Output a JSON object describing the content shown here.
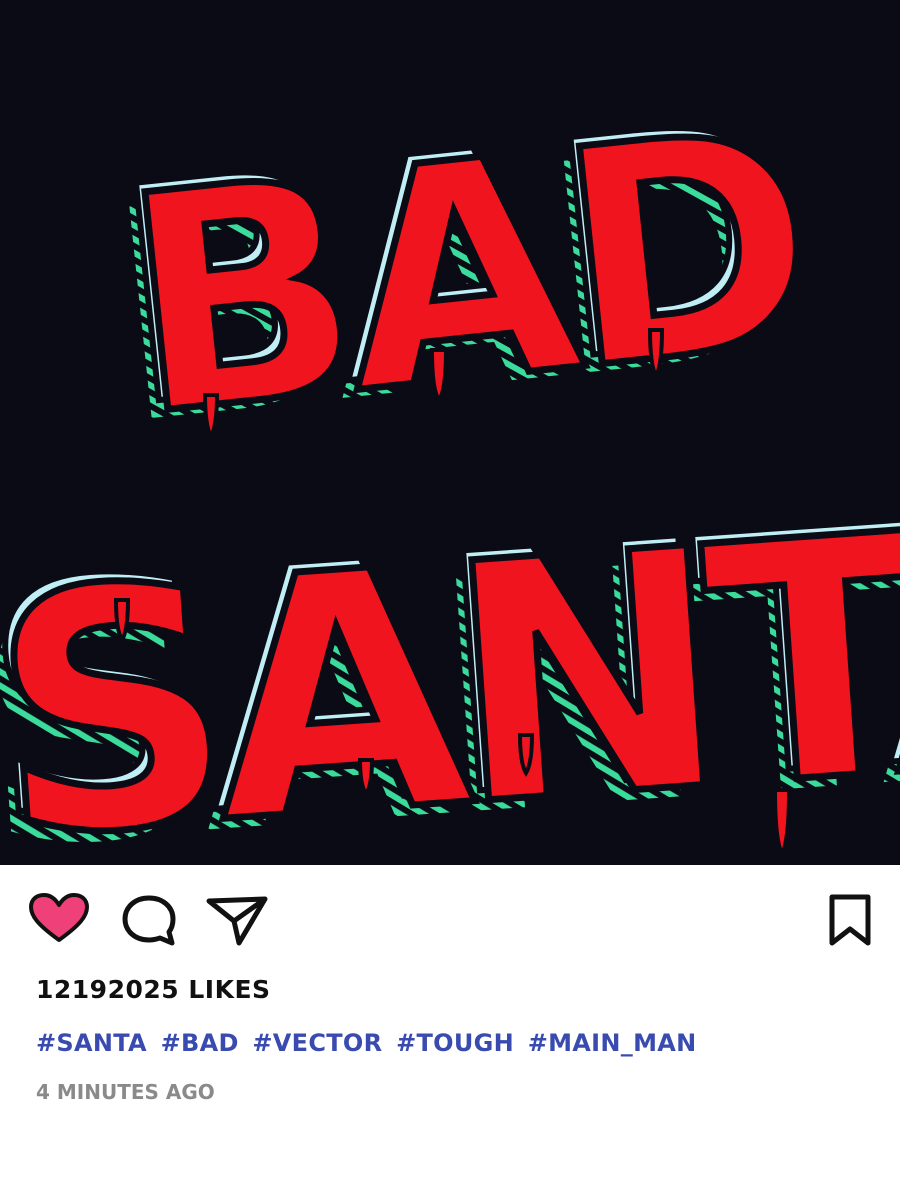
{
  "post": {
    "artwork_text": {
      "line1": "BAD",
      "line2": "SANTA"
    },
    "colors": {
      "background": "#0b0b16",
      "letter_fill": "#f0141e",
      "letter_shadow": "#3bdc9b",
      "letter_highlight": "#bfeff5",
      "like_heart": "#f0407a",
      "hashtag": "#3a4bb0",
      "timestamp": "#8a8a8a"
    },
    "icons": [
      "heart-icon",
      "comment-icon",
      "share-icon",
      "bookmark-icon"
    ],
    "liked": true,
    "likes_text": "12192025 LiKES",
    "hashtags": [
      "#SANTA",
      "#BAD",
      "#VECTOR",
      "#TOUGH",
      "#MAIN_MAN"
    ],
    "timestamp": "4 MiNUTES AGO"
  }
}
